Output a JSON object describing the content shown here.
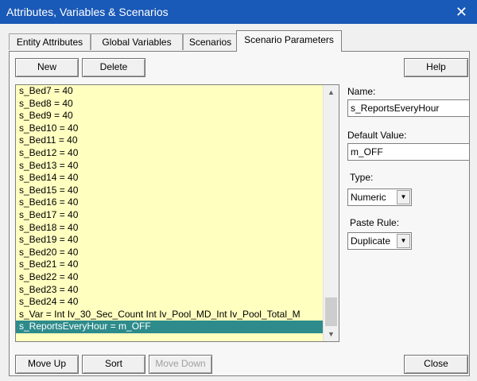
{
  "window": {
    "title": "Attributes, Variables & Scenarios"
  },
  "tabs": [
    {
      "label": "Entity Attributes"
    },
    {
      "label": "Global Variables"
    },
    {
      "label": "Scenarios"
    },
    {
      "label": "Scenario Parameters",
      "active": true
    }
  ],
  "toolbar": {
    "new_label": "New",
    "delete_label": "Delete",
    "help_label": "Help"
  },
  "list": {
    "items": [
      "s_Bed7 = 40",
      "s_Bed8 = 40",
      "s_Bed9 = 40",
      "s_Bed10 = 40",
      "s_Bed11 = 40",
      "s_Bed12 = 40",
      "s_Bed13 = 40",
      "s_Bed14 = 40",
      "s_Bed15 = 40",
      "s_Bed16 = 40",
      "s_Bed17 = 40",
      "s_Bed18 = 40",
      "s_Bed19 = 40",
      "s_Bed20 = 40",
      "s_Bed21 = 40",
      "s_Bed22 = 40",
      "s_Bed23 = 40",
      "s_Bed24 = 40",
      "s_Var = Int Iv_30_Sec_Count Int Iv_Pool_MD_Int Iv_Pool_Total_M",
      "s_ReportsEveryHour = m_OFF"
    ],
    "selected_index": 19
  },
  "fields": {
    "name_label": "Name:",
    "name_value": "s_ReportsEveryHour",
    "default_label": "Default Value:",
    "default_value": "m_OFF",
    "type_label": "Type:",
    "type_value": "Numeric",
    "paste_label": "Paste Rule:",
    "paste_value": "Duplicate"
  },
  "footer": {
    "move_up_label": "Move Up",
    "sort_label": "Sort",
    "move_down_label": "Move Down",
    "close_label": "Close"
  },
  "colors": {
    "titlebar": "#1959b7",
    "list_bg": "#ffffc0",
    "selection": "#2e8b8b"
  },
  "icons": {
    "close": "close-icon",
    "scroll_up": "chevron-up-icon",
    "scroll_down": "chevron-down-icon",
    "dropdown": "chevron-down-icon"
  }
}
